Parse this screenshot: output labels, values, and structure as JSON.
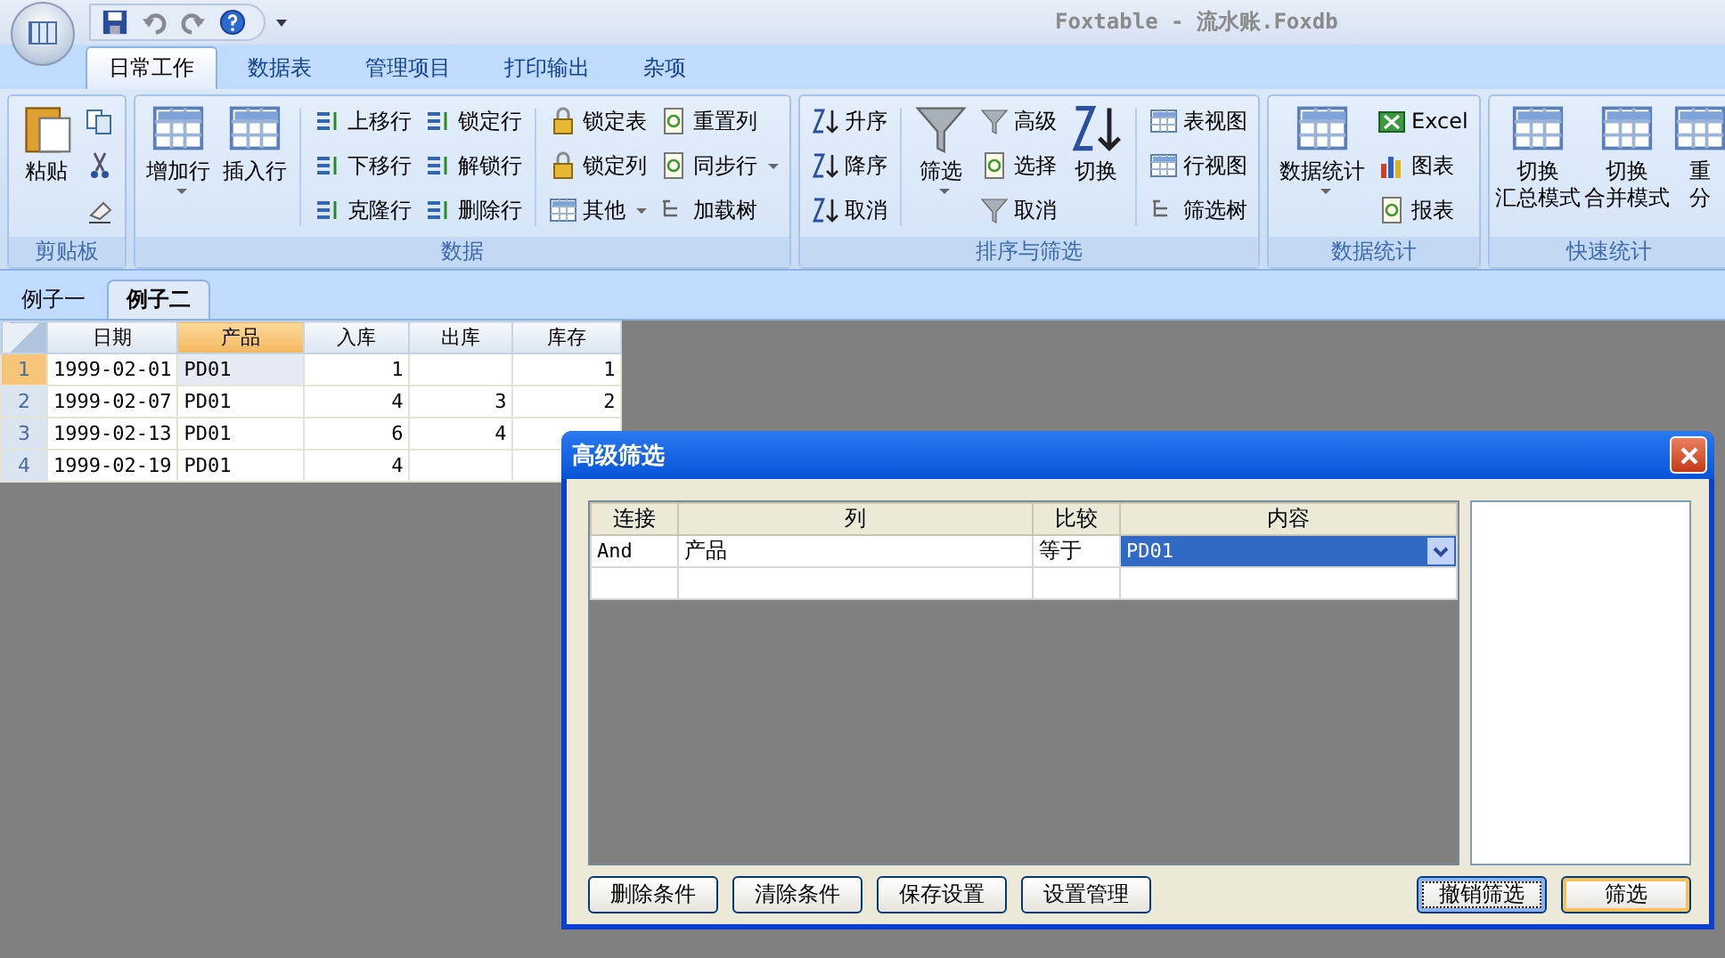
{
  "window": {
    "title": "Foxtable - 流水账.Foxdb"
  },
  "ribbon_tabs": [
    {
      "label": "日常工作",
      "selected": true
    },
    {
      "label": "数据表",
      "selected": false
    },
    {
      "label": "管理项目",
      "selected": false
    },
    {
      "label": "打印输出",
      "selected": false
    },
    {
      "label": "杂项",
      "selected": false
    }
  ],
  "ribbon_groups": [
    {
      "label": "剪贴板",
      "columns": [
        {
          "kind": "large",
          "label": "粘贴",
          "dropdown": false
        },
        {
          "kind": "stack",
          "items": [
            {
              "kind": "icon"
            },
            {
              "kind": "icon"
            },
            {
              "kind": "icon"
            }
          ]
        }
      ]
    },
    {
      "label": "数据",
      "columns": [
        {
          "kind": "large",
          "label": "增加行",
          "dropdown": true
        },
        {
          "kind": "large",
          "label": "插入行",
          "dropdown": false
        },
        {
          "kind": "separator"
        },
        {
          "kind": "stack",
          "items": [
            {
              "kind": "small",
              "label": "上移行",
              "dropdown": false
            },
            {
              "kind": "small",
              "label": "下移行",
              "dropdown": false
            },
            {
              "kind": "small",
              "label": "克隆行",
              "dropdown": false
            }
          ]
        },
        {
          "kind": "stack",
          "items": [
            {
              "kind": "small",
              "label": "锁定行",
              "dropdown": false
            },
            {
              "kind": "small",
              "label": "解锁行",
              "dropdown": false
            },
            {
              "kind": "small",
              "label": "删除行",
              "dropdown": false
            }
          ]
        },
        {
          "kind": "separator"
        },
        {
          "kind": "stack",
          "items": [
            {
              "kind": "small",
              "label": "锁定表",
              "dropdown": false
            },
            {
              "kind": "small",
              "label": "锁定列",
              "dropdown": false
            },
            {
              "kind": "small",
              "label": "其他",
              "dropdown": true
            }
          ]
        },
        {
          "kind": "stack",
          "items": [
            {
              "kind": "small",
              "label": "重置列",
              "dropdown": false
            },
            {
              "kind": "small",
              "label": "同步行",
              "dropdown": true
            },
            {
              "kind": "small",
              "label": "加载树",
              "dropdown": false
            }
          ]
        }
      ]
    },
    {
      "label": "排序与筛选",
      "columns": [
        {
          "kind": "stack",
          "items": [
            {
              "kind": "small",
              "label": "升序",
              "dropdown": false
            },
            {
              "kind": "small",
              "label": "降序",
              "dropdown": false
            },
            {
              "kind": "small",
              "label": "取消",
              "dropdown": false
            }
          ]
        },
        {
          "kind": "separator"
        },
        {
          "kind": "large",
          "label": "筛选",
          "dropdown": true
        },
        {
          "kind": "stack",
          "items": [
            {
              "kind": "small",
              "label": "高级",
              "dropdown": false
            },
            {
              "kind": "small",
              "label": "选择",
              "dropdown": false
            },
            {
              "kind": "small",
              "label": "取消",
              "dropdown": false
            }
          ]
        },
        {
          "kind": "large",
          "label": "切换",
          "dropdown": false
        },
        {
          "kind": "separator"
        },
        {
          "kind": "stack",
          "items": [
            {
              "kind": "small",
              "label": "表视图",
              "dropdown": false
            },
            {
              "kind": "small",
              "label": "行视图",
              "dropdown": false
            },
            {
              "kind": "small",
              "label": "筛选树",
              "dropdown": false
            }
          ]
        }
      ]
    },
    {
      "label": "数据统计",
      "columns": [
        {
          "kind": "large",
          "label": "数据统计",
          "dropdown": true
        },
        {
          "kind": "stack",
          "items": [
            {
              "kind": "small",
              "label": "Excel",
              "dropdown": false
            },
            {
              "kind": "small",
              "label": "图表",
              "dropdown": false
            },
            {
              "kind": "small",
              "label": "报表",
              "dropdown": false
            }
          ]
        }
      ]
    },
    {
      "label": "快速统计",
      "columns": [
        {
          "kind": "large",
          "lines": [
            "切换",
            "汇总模式"
          ],
          "dropdown": false
        },
        {
          "kind": "large",
          "lines": [
            "切换",
            "合并模式"
          ],
          "dropdown": false
        },
        {
          "kind": "large",
          "lines": [
            "重",
            "分"
          ],
          "dropdown": false
        }
      ]
    }
  ],
  "sheet_tabs": [
    {
      "label": "例子一",
      "selected": false
    },
    {
      "label": "例子二",
      "selected": true
    }
  ],
  "table": {
    "columns": [
      {
        "label": "日期",
        "selected": false
      },
      {
        "label": "产品",
        "selected": true
      },
      {
        "label": "入库",
        "selected": false
      },
      {
        "label": "出库",
        "selected": false
      },
      {
        "label": "库存",
        "selected": false
      }
    ],
    "rows": [
      {
        "number": "1",
        "selected": true,
        "cells": [
          "1999-02-01",
          "PD01",
          "1",
          null,
          "1"
        ]
      },
      {
        "number": "2",
        "selected": false,
        "cells": [
          "1999-02-07",
          "PD01",
          "4",
          "3",
          "2"
        ]
      },
      {
        "number": "3",
        "selected": false,
        "cells": [
          "1999-02-13",
          "PD01",
          "6",
          "4",
          null
        ]
      },
      {
        "number": "4",
        "selected": false,
        "cells": [
          "1999-02-19",
          "PD01",
          "4",
          null,
          null
        ]
      }
    ]
  },
  "dialog": {
    "title": "高级筛选",
    "columns": [
      "连接",
      "列",
      "比较",
      "内容"
    ],
    "rows": [
      {
        "cells": [
          {
            "text": "And",
            "selected": false
          },
          {
            "text": "产品",
            "selected": false
          },
          {
            "text": "等于",
            "selected": false
          },
          {
            "text": "PD01",
            "selected": true
          }
        ]
      }
    ],
    "buttons": [
      {
        "label": "删除条件",
        "focused": false,
        "default": false
      },
      {
        "label": "清除条件",
        "focused": false,
        "default": false
      },
      {
        "label": "保存设置",
        "focused": false,
        "default": false
      },
      {
        "label": "设置管理",
        "focused": false,
        "default": false
      }
    ],
    "actions": [
      {
        "label": "撤销筛选",
        "focused": true,
        "default": false
      },
      {
        "label": "筛选",
        "focused": false,
        "default": true
      }
    ]
  }
}
